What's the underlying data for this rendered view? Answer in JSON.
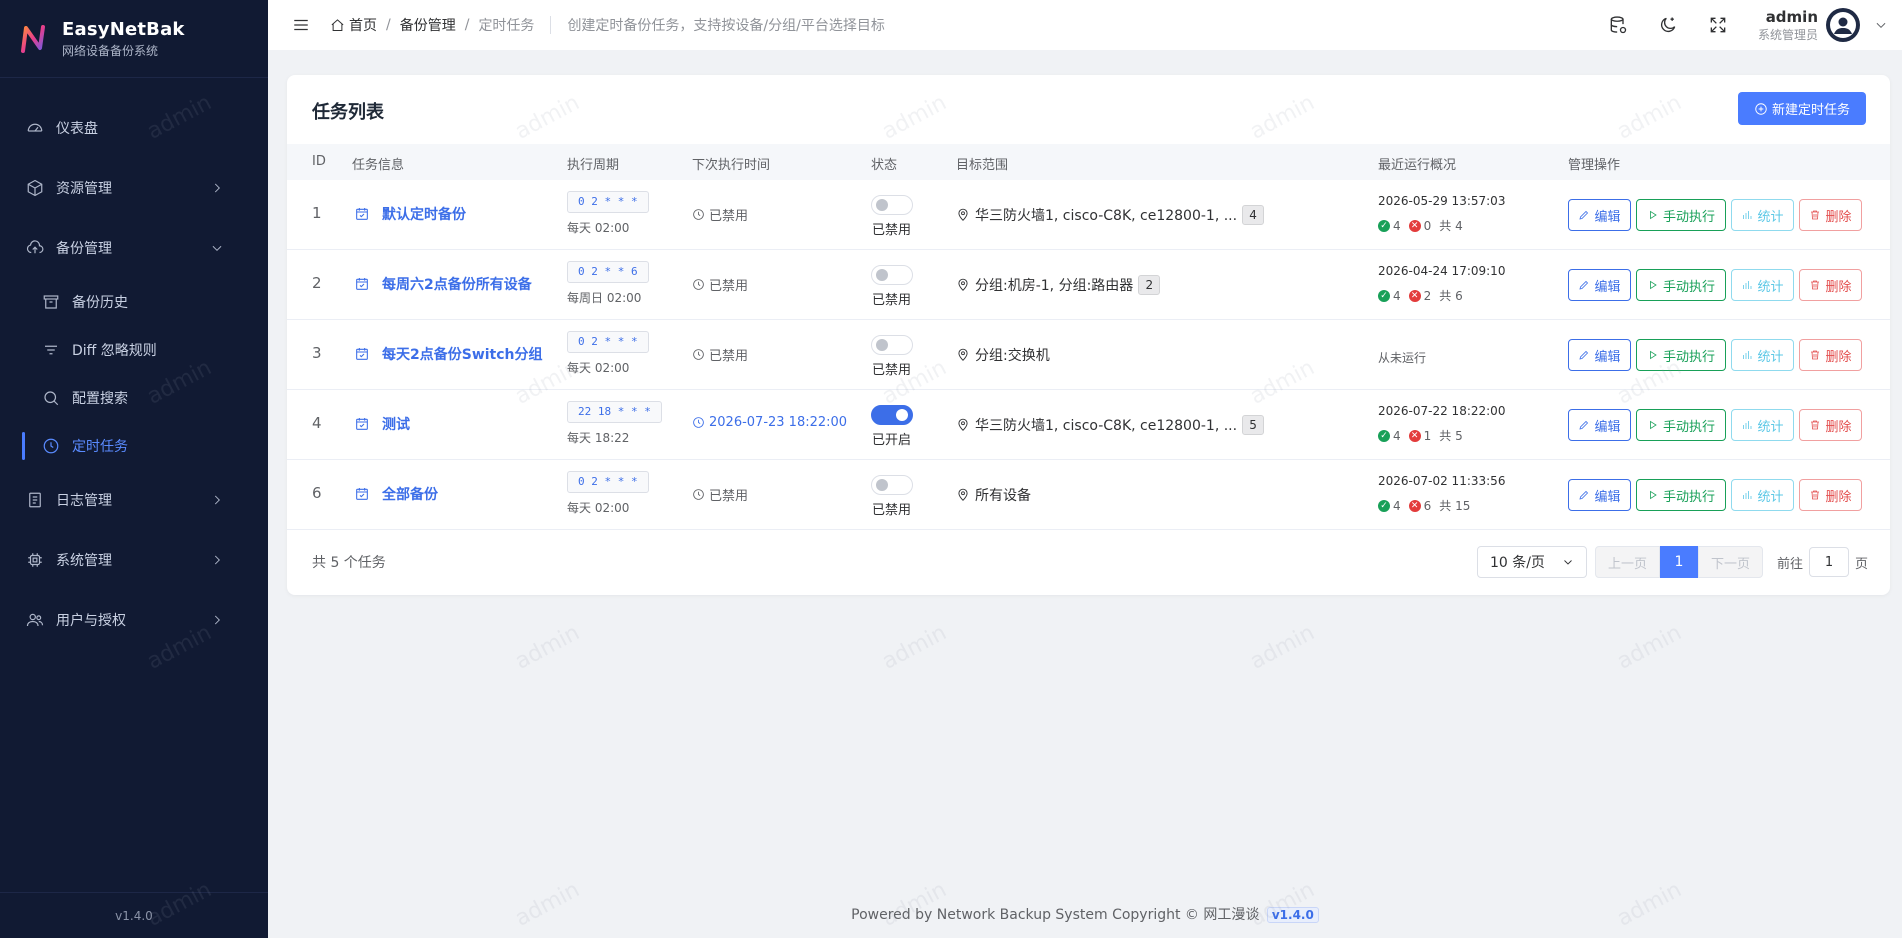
{
  "app": {
    "name": "EasyNetBak",
    "subtitle": "网络设备备份系统",
    "version": "v1.4.0"
  },
  "sidebar": {
    "items": [
      {
        "label": "仪表盘",
        "icon": "dashboard-icon"
      },
      {
        "label": "资源管理",
        "icon": "cube-icon"
      },
      {
        "label": "备份管理",
        "icon": "cloud-upload-icon"
      },
      {
        "label": "备份历史",
        "icon": "archive-icon"
      },
      {
        "label": "Diff 忽略规则",
        "icon": "filter-icon"
      },
      {
        "label": "配置搜索",
        "icon": "search-icon"
      },
      {
        "label": "定时任务",
        "icon": "clock-icon"
      },
      {
        "label": "日志管理",
        "icon": "document-icon"
      },
      {
        "label": "系统管理",
        "icon": "cpu-icon"
      },
      {
        "label": "用户与授权",
        "icon": "users-icon"
      }
    ]
  },
  "header": {
    "breadcrumb": [
      "首页",
      "备份管理",
      "定时任务"
    ],
    "description": "创建定时备份任务，支持按设备/分组/平台选择目标",
    "user": {
      "name": "admin",
      "role": "系统管理员"
    }
  },
  "card": {
    "title": "任务列表",
    "new_button": "新建定时任务",
    "columns": [
      "ID",
      "任务信息",
      "执行周期",
      "下次执行时间",
      "状态",
      "目标范围",
      "最近运行概况",
      "管理操作"
    ],
    "actions": {
      "edit": "编辑",
      "run": "手动执行",
      "stats": "统计",
      "delete": "删除"
    },
    "rows": [
      {
        "id": "1",
        "name": "默认定时备份",
        "cron": "0 2 * * *",
        "cron_desc": "每天 02:00",
        "next": "已禁用",
        "enabled": false,
        "status": "已禁用",
        "target": "华三防火墙1, cisco-C8K, ce12800-1, ...",
        "count": "4",
        "last_time": "2026-05-29 13:57:03",
        "ok": "4",
        "fail": "0",
        "total": "共 4"
      },
      {
        "id": "2",
        "name": "每周六2点备份所有设备",
        "cron": "0 2 * * 6",
        "cron_desc": "每周日 02:00",
        "next": "已禁用",
        "enabled": false,
        "status": "已禁用",
        "target": "分组:机房-1, 分组:路由器",
        "count": "2",
        "last_time": "2026-04-24 17:09:10",
        "ok": "4",
        "fail": "2",
        "total": "共 6"
      },
      {
        "id": "3",
        "name": "每天2点备份Switch分组",
        "cron": "0 2 * * *",
        "cron_desc": "每天 02:00",
        "next": "已禁用",
        "enabled": false,
        "status": "已禁用",
        "target": "分组:交换机",
        "count": "",
        "last_time": "",
        "never": "从未运行"
      },
      {
        "id": "4",
        "name": "测试",
        "cron": "22 18 * * *",
        "cron_desc": "每天 18:22",
        "next": "2026-07-23 18:22:00",
        "enabled": true,
        "status": "已开启",
        "target": "华三防火墙1, cisco-C8K, ce12800-1, ...",
        "count": "5",
        "last_time": "2026-07-22 18:22:00",
        "ok": "4",
        "fail": "1",
        "total": "共 5"
      },
      {
        "id": "6",
        "name": "全部备份",
        "cron": "0 2 * * *",
        "cron_desc": "每天 02:00",
        "next": "已禁用",
        "enabled": false,
        "status": "已禁用",
        "target": "所有设备",
        "count": "",
        "last_time": "2026-07-02 11:33:56",
        "ok": "4",
        "fail": "6",
        "total": "共 15"
      }
    ],
    "total_text": "共 5 个任务",
    "pagination": {
      "page_size": "10 条/页",
      "prev": "上一页",
      "page": "1",
      "next": "下一页",
      "goto_label": "前往",
      "goto_value": "1",
      "goto_unit": "页"
    }
  },
  "footer": {
    "text": "Powered by Network Backup System Copyright © 网工漫谈",
    "version": "v1.4.0"
  },
  "watermark": "admin",
  "colors": {
    "primary": "#4a7cff",
    "sidebar": "#111a33",
    "success": "#18a058",
    "danger": "#e33b3b"
  }
}
